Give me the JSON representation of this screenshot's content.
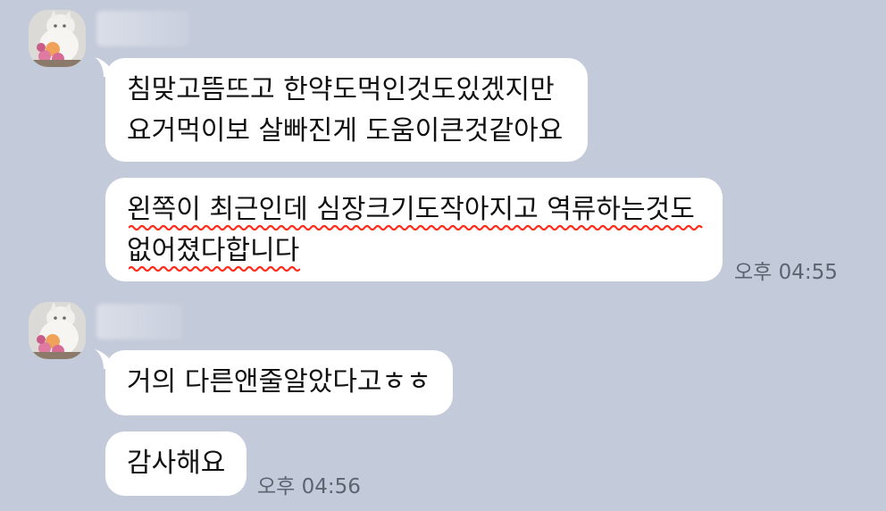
{
  "conversation": {
    "groups": [
      {
        "sender_name": "",
        "messages": [
          {
            "lines": [
              "침맞고뜸뜨고 한약도먹인것도있겠지만",
              "요거먹이보 살빠진게 도움이큰것같아요"
            ],
            "spellcheck_underline": false
          },
          {
            "lines": [
              "왼쪽이 최근인데 심장크기도작아지고 역류하는것도",
              "없어졌다합니다"
            ],
            "spellcheck_underline": true
          }
        ],
        "time": "오후 04:55"
      },
      {
        "sender_name": "",
        "messages": [
          {
            "lines": [
              "거의 다른앤줄알았다고ㅎㅎ"
            ],
            "spellcheck_underline": false
          },
          {
            "lines": [
              "감사해요"
            ],
            "spellcheck_underline": false
          }
        ],
        "time": "오후 04:56"
      }
    ]
  },
  "colors": {
    "background": "#c3cad9",
    "bubble": "#ffffff",
    "time_text": "#5d6471",
    "spellcheck": "#ff2a1a"
  }
}
